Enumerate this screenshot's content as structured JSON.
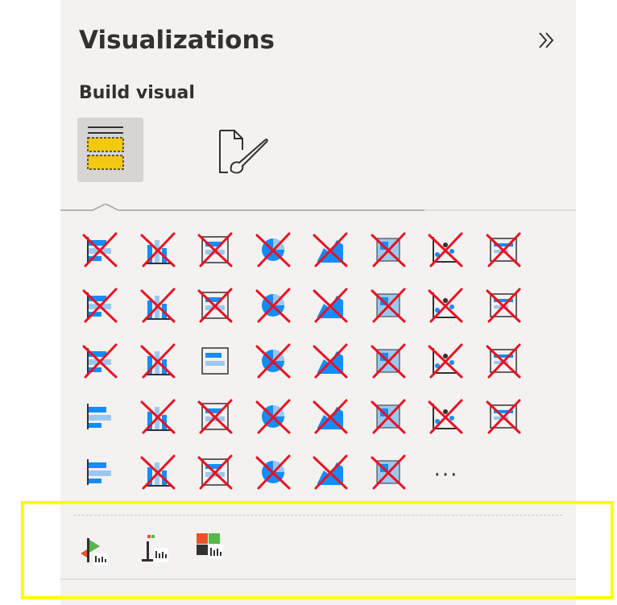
{
  "panel": {
    "title": "Visualizations",
    "subtitle": "Build visual",
    "more_label": "···"
  },
  "tabs": [
    {
      "name": "build-visual",
      "icon": "fields-well-icon",
      "active": true
    },
    {
      "name": "format-visual",
      "icon": "paintbrush-page-icon",
      "active": false
    }
  ],
  "visuals": {
    "rows": [
      [
        "stacked-bar-chart-icon",
        "stacked-column-chart-icon",
        "clustered-bar-chart-icon",
        "clustered-column-chart-icon",
        "100-stacked-bar-chart-icon",
        "100-stacked-column-chart-icon",
        "line-chart-icon",
        "area-chart-icon"
      ],
      [
        "stacked-area-chart-icon",
        "line-and-column-chart-icon",
        "line-and-clustered-column-chart-icon",
        "ribbon-chart-icon",
        "waterfall-chart-icon",
        "funnel-icon",
        "scatter-chart-icon",
        "pie-chart-icon"
      ],
      [
        "donut-chart-icon",
        "treemap-icon",
        "map-icon",
        "filled-map-icon",
        "gauge-icon",
        "card-icon",
        "multi-row-card-icon",
        "kpi-icon"
      ],
      [
        "slicer-icon",
        "table-icon",
        "matrix-icon",
        "r-script-visual-icon",
        "python-visual-icon",
        "key-influencers-icon",
        "decomposition-tree-icon",
        "qa-icon"
      ],
      [
        "smart-narrative-icon",
        "metrics-icon",
        "paginated-report-icon",
        "azure-map-icon",
        "power-apps-icon",
        "power-automate-icon"
      ]
    ],
    "crossed_out_color": "#e81123",
    "uncrossed": [
      "slicer-icon",
      "smart-narrative-icon",
      "map-icon"
    ]
  },
  "custom_visuals": [
    "custom-visual-1-icon",
    "custom-visual-2-icon",
    "custom-visual-3-icon"
  ],
  "colors": {
    "highlight": "#ffff00",
    "accent": "#f2c811"
  }
}
